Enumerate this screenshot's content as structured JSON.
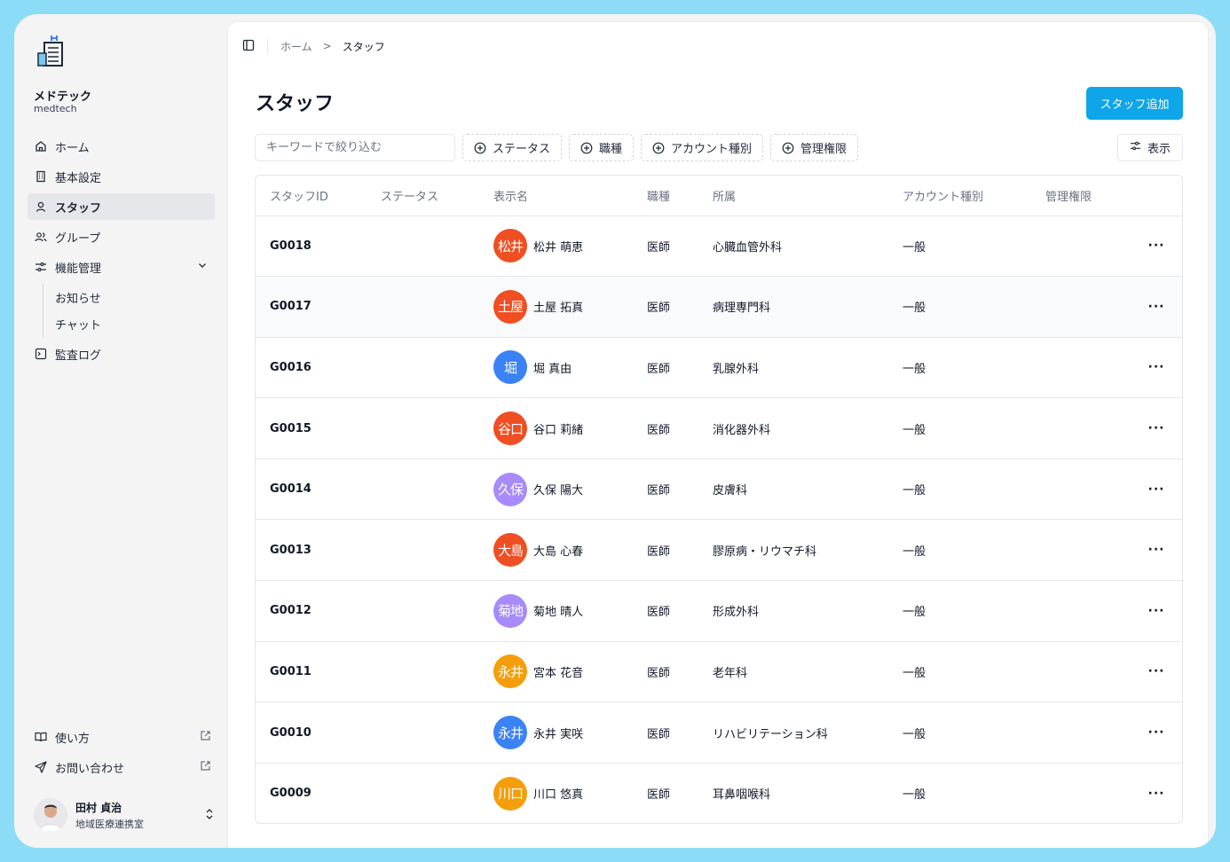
{
  "brand": {
    "name": "メドテック",
    "sub": "medtech"
  },
  "sidebar": {
    "items": [
      {
        "label": "ホーム",
        "icon": "home-icon"
      },
      {
        "label": "基本設定",
        "icon": "building-icon"
      },
      {
        "label": "スタッフ",
        "icon": "user-icon",
        "active": true
      },
      {
        "label": "グループ",
        "icon": "users-icon"
      },
      {
        "label": "機能管理",
        "icon": "sliders-icon"
      },
      {
        "label": "監査ログ",
        "icon": "terminal-icon"
      }
    ],
    "sub_items": [
      "お知らせ",
      "チャット"
    ],
    "bottom": [
      {
        "label": "使い方",
        "icon": "book-icon"
      },
      {
        "label": "お問い合わせ",
        "icon": "send-icon"
      }
    ],
    "user": {
      "name": "田村 貞治",
      "dept": "地域医療連携室"
    }
  },
  "breadcrumb": {
    "home": "ホーム",
    "sep": ">",
    "current": "スタッフ"
  },
  "page": {
    "title": "スタッフ",
    "add_label": "スタッフ追加"
  },
  "filters": {
    "search_placeholder": "キーワードで絞り込む",
    "buttons": [
      "ステータス",
      "職種",
      "アカウント種別",
      "管理権限"
    ],
    "view_label": "表示"
  },
  "table": {
    "columns": [
      "スタッフID",
      "ステータス",
      "表示名",
      "職種",
      "所属",
      "アカウント種別",
      "管理権限"
    ],
    "more_label": "···",
    "rows": [
      {
        "id": "G0018",
        "initials": "松井",
        "color": "#f04e23",
        "name": "松井 萌恵",
        "job": "医師",
        "dept": "心臓血管外科",
        "account": "一般"
      },
      {
        "id": "G0017",
        "initials": "土屋",
        "color": "#f04e23",
        "name": "土屋 拓真",
        "job": "医師",
        "dept": "病理専門科",
        "account": "一般"
      },
      {
        "id": "G0016",
        "initials": "堀",
        "color": "#3b82f6",
        "name": "堀 真由",
        "job": "医師",
        "dept": "乳腺外科",
        "account": "一般"
      },
      {
        "id": "G0015",
        "initials": "谷口",
        "color": "#f04e23",
        "name": "谷口 莉緒",
        "job": "医師",
        "dept": "消化器外科",
        "account": "一般"
      },
      {
        "id": "G0014",
        "initials": "久保",
        "color": "#a78bfa",
        "name": "久保 陽大",
        "job": "医師",
        "dept": "皮膚科",
        "account": "一般"
      },
      {
        "id": "G0013",
        "initials": "大島",
        "color": "#f04e23",
        "name": "大島 心春",
        "job": "医師",
        "dept": "膠原病・リウマチ科",
        "account": "一般"
      },
      {
        "id": "G0012",
        "initials": "菊地",
        "color": "#a78bfa",
        "name": "菊地 晴人",
        "job": "医師",
        "dept": "形成外科",
        "account": "一般"
      },
      {
        "id": "G0011",
        "initials": "永井",
        "color": "#f59e0b",
        "name": "宮本 花音",
        "job": "医師",
        "dept": "老年科",
        "account": "一般"
      },
      {
        "id": "G0010",
        "initials": "永井",
        "color": "#3b82f6",
        "name": "永井 実咲",
        "job": "医師",
        "dept": "リハビリテーション科",
        "account": "一般"
      },
      {
        "id": "G0009",
        "initials": "川口",
        "color": "#f59e0b",
        "name": "川口 悠真",
        "job": "医師",
        "dept": "耳鼻咽喉科",
        "account": "一般"
      }
    ]
  },
  "colors": {
    "accent": "#0ea5e9",
    "frame": "#8ddcf7"
  }
}
